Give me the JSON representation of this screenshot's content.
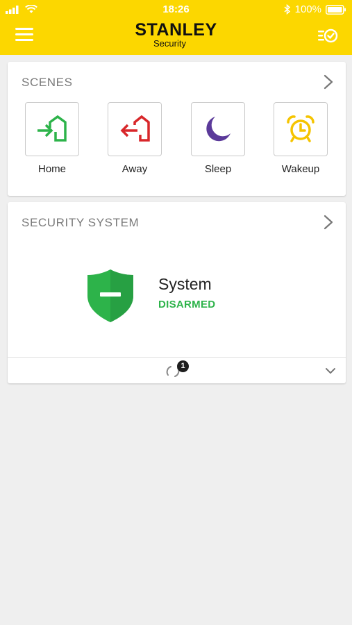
{
  "status_bar": {
    "time": "18:26",
    "battery": "100%",
    "icons": [
      "signal-icon",
      "wifi-icon",
      "bluetooth-icon",
      "battery-icon"
    ]
  },
  "header": {
    "brand": "STANLEY",
    "brand_sub": "Security",
    "menu_icon": "hamburger-menu-icon",
    "timeline_icon": "timeline-check-icon",
    "color": "#fcd700"
  },
  "scenes": {
    "title": "SCENES",
    "items": [
      {
        "label": "Home",
        "icon": "home-arrive-icon",
        "color": "#2db34a"
      },
      {
        "label": "Away",
        "icon": "home-leave-icon",
        "color": "#d8272a"
      },
      {
        "label": "Sleep",
        "icon": "moon-icon",
        "color": "#5b3a9a"
      },
      {
        "label": "Wakeup",
        "icon": "alarm-clock-icon",
        "color": "#f5c400"
      }
    ]
  },
  "security": {
    "title": "SECURITY SYSTEM",
    "system_name": "System",
    "system_status": "DISARMED",
    "status_color": "#2db34a",
    "sync_badge": "1"
  }
}
